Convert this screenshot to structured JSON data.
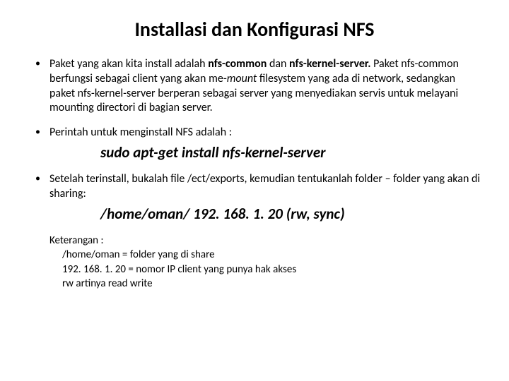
{
  "title": "Installasi dan Konfigurasi NFS",
  "bullets": {
    "b1_pre": "Paket yang akan kita install adalah ",
    "b1_strong": "nfs-common",
    "b1_mid1": " dan ",
    "b1_strong2": "nfs-kernel-server. ",
    "b1_mid2": "Paket nfs-common berfungsi sebagai client yang akan me-",
    "b1_italic": "mount",
    "b1_post": " filesystem yang ada di network,  sedangkan paket nfs-kernel-server berperan sebagai server yang menyediakan servis untuk melayani mounting directori di bagian server.",
    "b2": "Perintah untuk menginstall NFS adalah :",
    "cmd1": "sudo apt-get install nfs-kernel-server",
    "b3": "Setelah terinstall, bukalah file /ect/exports, kemudian tentukanlah folder – folder yang akan di sharing:",
    "cmd2": "/home/oman/ 192. 168. 1. 20 (rw, sync)"
  },
  "ket": {
    "heading": "Keterangan :",
    "l1": "/home/oman   = folder yang di share",
    "l2": "192. 168. 1. 20   =  nomor IP client yang punya hak akses",
    "l3": "rw artinya read write"
  }
}
